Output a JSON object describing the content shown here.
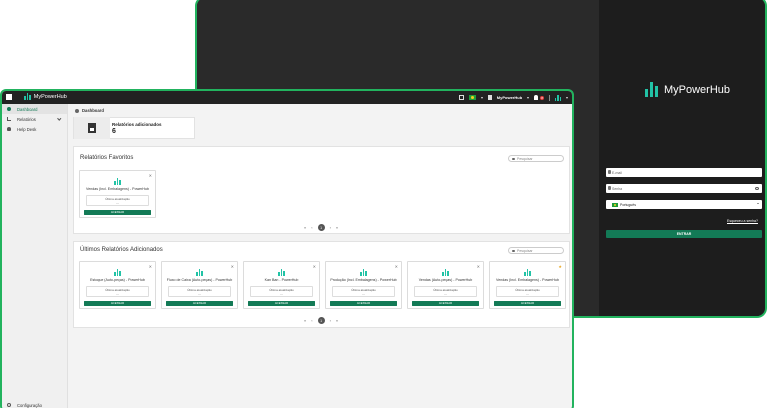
{
  "login": {
    "brand": "MyPowerHub",
    "email_placeholder": "E-mail",
    "password_placeholder": "Senha",
    "language": "Português",
    "forgot_password": "Esqueceu a senha?",
    "submit_label": "ENTRAR"
  },
  "app": {
    "brand": "MyPowerHub",
    "workspace": "MyPowerHub",
    "notifications_count": "8",
    "accent_color": "#137a56",
    "chart_color": "#22c3a6"
  },
  "sidebar": {
    "items": [
      {
        "label": "Dashboard",
        "icon": "home-icon"
      },
      {
        "label": "Relatórios",
        "icon": "chart-icon"
      },
      {
        "label": "Help Desk",
        "icon": "user-icon"
      }
    ],
    "settings_label": "Configuração"
  },
  "dashboard": {
    "breadcrumb": "Dashboard",
    "kpi": {
      "title": "Relatórios adicionados",
      "value": "6"
    }
  },
  "favorites": {
    "title": "Relatórios Favoritos",
    "search_placeholder": "Pesquisar",
    "cards": [
      {
        "name": "Vendas (Incl. Embalagens) - PowerHub",
        "updated_label": "Última atualização",
        "updated_value": "---",
        "button": "ACESSAR"
      }
    ],
    "pager": {
      "page": "1"
    }
  },
  "recent": {
    "title": "Últimos Relatórios Adicionados",
    "search_placeholder": "Pesquisar",
    "cards": [
      {
        "name": "Estoque (Auto-peças) - PowerHub",
        "updated_label": "Última atualização",
        "updated_value": "---",
        "button": "ACESSAR",
        "favorite": false
      },
      {
        "name": "Fluxo de Caixa (Auto-peças) - PowerHub",
        "updated_label": "Última atualização",
        "updated_value": "---",
        "button": "ACESSAR",
        "favorite": false
      },
      {
        "name": "Kan Ban - PowerHub",
        "updated_label": "Última atualização",
        "updated_value": "---",
        "button": "ACESSAR",
        "favorite": false
      },
      {
        "name": "Produção (Incl. Embalagens) - PowerHub",
        "updated_label": "Última atualização",
        "updated_value": "---",
        "button": "ACESSAR",
        "favorite": false
      },
      {
        "name": "Vendas (Auto-peças) - PowerHub",
        "updated_label": "Última atualização",
        "updated_value": "---",
        "button": "ACESSAR",
        "favorite": false
      },
      {
        "name": "Vendas (Incl. Embalagens) - PowerHub",
        "updated_label": "Última atualização",
        "updated_value": "---",
        "button": "ACESSAR",
        "favorite": true
      }
    ],
    "pager": {
      "page": "1"
    }
  }
}
